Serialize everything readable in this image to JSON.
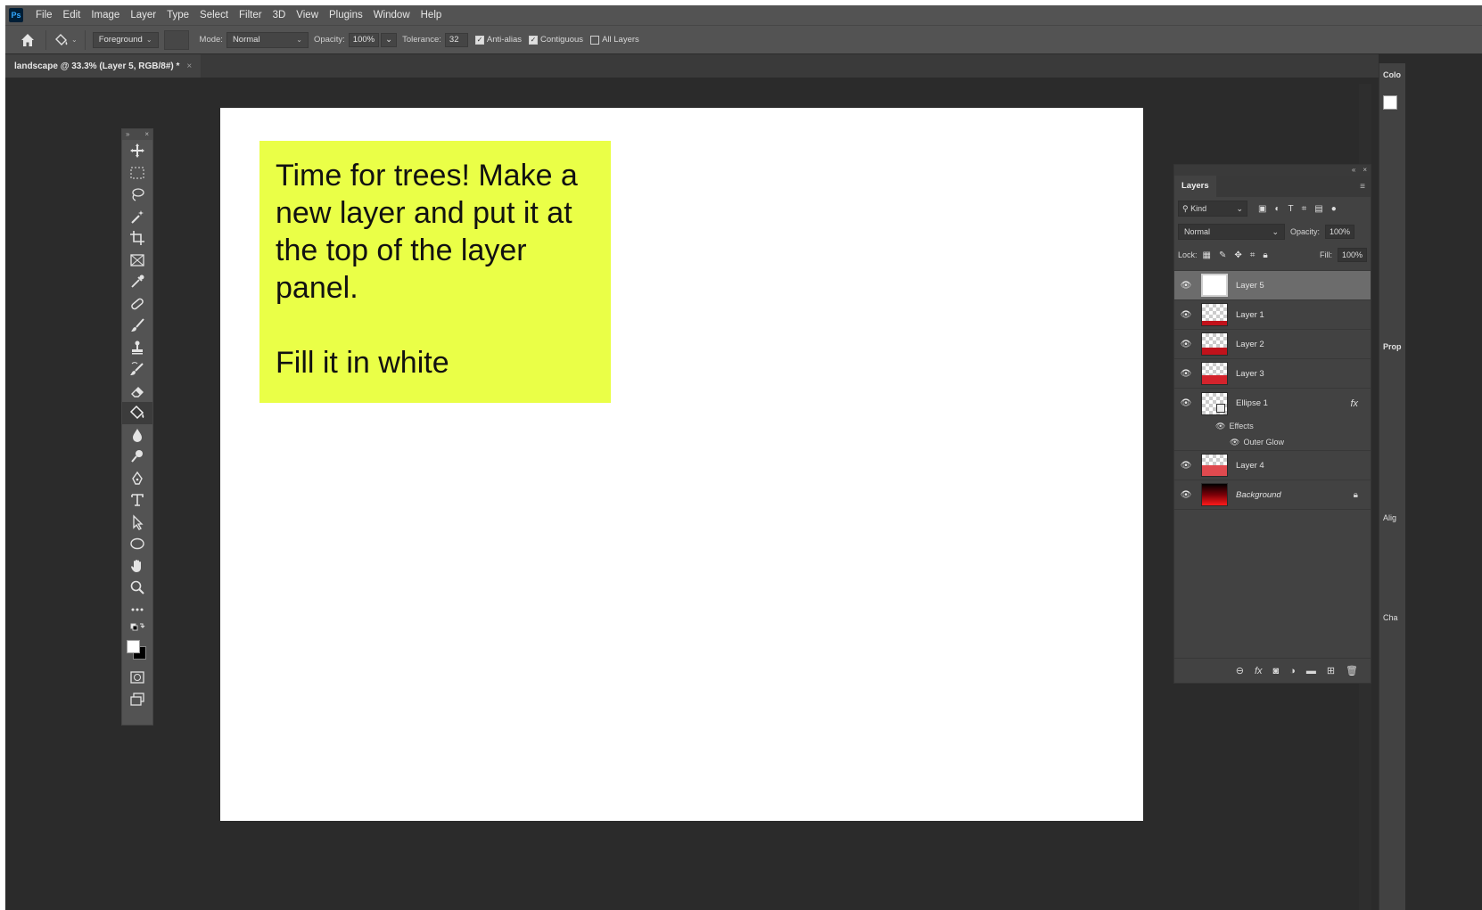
{
  "app": {
    "logo": "Ps"
  },
  "menu": [
    "File",
    "Edit",
    "Image",
    "Layer",
    "Type",
    "Select",
    "Filter",
    "3D",
    "View",
    "Plugins",
    "Window",
    "Help"
  ],
  "options": {
    "fill_source": "Foreground",
    "mode_label": "Mode:",
    "mode_value": "Normal",
    "opacity_label": "Opacity:",
    "opacity_value": "100%",
    "tolerance_label": "Tolerance:",
    "tolerance_value": "32",
    "anti_alias_label": "Anti-alias",
    "anti_alias_checked": true,
    "contiguous_label": "Contiguous",
    "contiguous_checked": true,
    "all_layers_label": "All Layers",
    "all_layers_checked": false
  },
  "document": {
    "tab_title": "landscape @ 33.3% (Layer 5, RGB/8#) *",
    "close_glyph": "×"
  },
  "note": {
    "text": "Time for trees! Make a new layer and put it at the top of the layer panel.\n\nFill it in white",
    "color": "#eaff47"
  },
  "layers_panel": {
    "title": "Layers",
    "filter_label": "Kind",
    "blend_mode": "Normal",
    "opacity_label": "Opacity:",
    "opacity_value": "100%",
    "lock_label": "Lock:",
    "fill_label": "Fill:",
    "fill_value": "100%",
    "layers": [
      {
        "name": "Layer 5",
        "thumb": "white",
        "selected": true
      },
      {
        "name": "Layer 1",
        "thumb": "checker-red-small"
      },
      {
        "name": "Layer 2",
        "thumb": "checker-red-medium"
      },
      {
        "name": "Layer 3",
        "thumb": "checker-red-large"
      },
      {
        "name": "Ellipse 1",
        "thumb": "checker-shape",
        "fx": "fx",
        "effects_label": "Effects",
        "effect_items": [
          "Outer Glow"
        ]
      },
      {
        "name": "Layer 4",
        "thumb": "checker-red-bottom"
      },
      {
        "name": "Background",
        "thumb": "gradient",
        "italic": true,
        "locked": true
      }
    ]
  },
  "dock": {
    "color_label": "Colo",
    "properties_label": "Prop",
    "align_label": "Alig",
    "char_label": "Cha"
  },
  "colors": {
    "fg": "#ffffff",
    "bg": "#000000",
    "accent": "#31a8ff"
  }
}
